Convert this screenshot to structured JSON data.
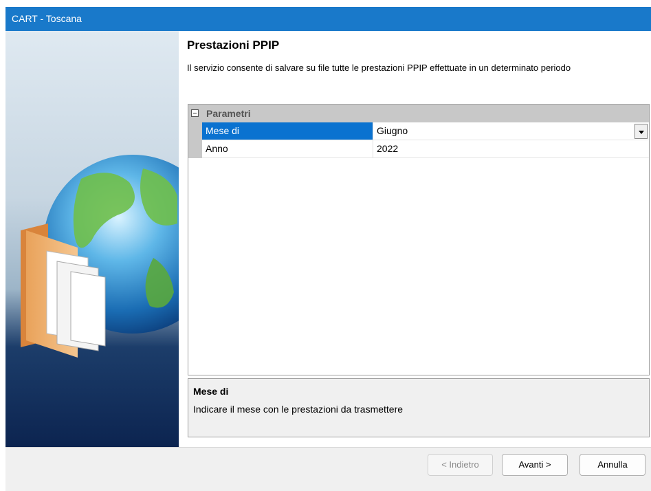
{
  "window": {
    "title": "CART - Toscana"
  },
  "page": {
    "title": "Prestazioni PPIP",
    "description": "Il servizio consente di salvare su file tutte le prestazioni PPIP effettuate in un determinato periodo"
  },
  "grid": {
    "category": "Parametri",
    "rows": [
      {
        "name": "Mese di",
        "value": "Giugno"
      },
      {
        "name": "Anno",
        "value": "2022"
      }
    ]
  },
  "help": {
    "title": "Mese di",
    "text": "Indicare il mese con le prestazioni da trasmettere"
  },
  "buttons": {
    "back": "< Indietro",
    "next": "Avanti >",
    "cancel": "Annulla"
  },
  "colors": {
    "titlebar": "#1979ca",
    "selection": "#0a72d0"
  }
}
